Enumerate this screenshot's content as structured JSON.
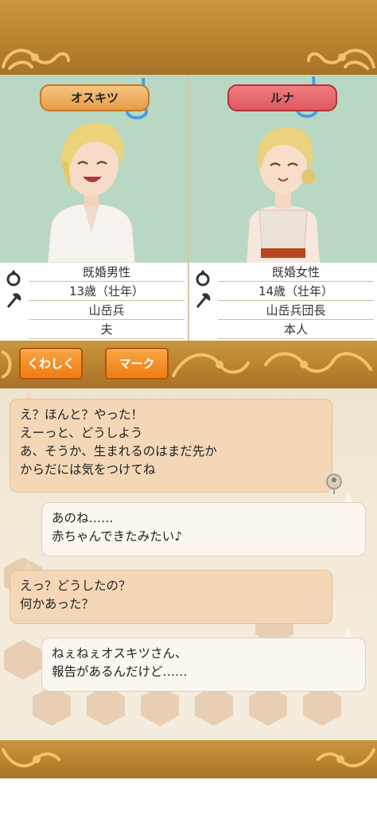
{
  "characters": {
    "left": {
      "name": "オスキツ",
      "marital": "既婚男性",
      "age": "13歳（壮年）",
      "job": "山岳兵",
      "relation": "夫"
    },
    "right": {
      "name": "ルナ",
      "marital": "既婚女性",
      "age": "14歳（壮年）",
      "job": "山岳兵団長",
      "relation": "本人"
    }
  },
  "buttons": {
    "detail": "くわしく",
    "mark": "マーク"
  },
  "chat": [
    {
      "side": "left",
      "text": "え？ほんと？やった！\nえーっと、どうしよう\nあ、そうか、生まれるのはまだ先か\nからだには気をつけてね"
    },
    {
      "side": "right",
      "text": "あのね……\n赤ちゃんできたみたい♪"
    },
    {
      "side": "left",
      "text": "えっ？どうしたの？\n何かあった？"
    },
    {
      "side": "right",
      "text": "ねぇねぇオスキツさん、\n報告があるんだけど……"
    }
  ],
  "colors": {
    "frame": "#b9822f",
    "button": "#ee7c13",
    "male_tag": "#e59c48",
    "female_tag": "#de5a61",
    "portrait_bg": "#b9d8c4"
  },
  "icons": [
    "ring-icon",
    "axe-icon",
    "music-note-icon",
    "pin-icon"
  ]
}
